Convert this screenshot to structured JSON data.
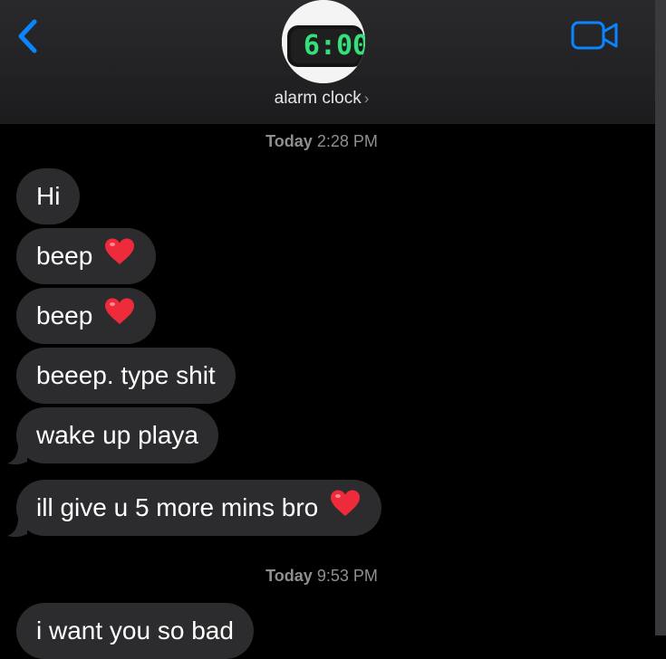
{
  "header": {
    "contact_name": "alarm clock",
    "avatar_clock_text": "6:00"
  },
  "timestamps": [
    {
      "day": "Today",
      "time": "2:28 PM"
    },
    {
      "day": "Today",
      "time": "9:53 PM"
    }
  ],
  "messages": [
    {
      "text": "Hi"
    },
    {
      "text": "beep",
      "emoji": "red-heart"
    },
    {
      "text": "beep",
      "emoji": "red-heart"
    },
    {
      "text": "beeep. type shit"
    },
    {
      "text": "wake up playa"
    },
    {
      "text": "ill give u 5 more mins bro",
      "emoji": "red-heart"
    },
    {
      "text": "i want you so bad"
    }
  ],
  "colors": {
    "accent": "#0a84ff",
    "bubble_incoming": "#2c2c2e",
    "background": "#000000",
    "clock_digits": "#35e07a"
  },
  "icons": [
    "back-chevron-icon",
    "video-camera-icon",
    "red-heart-icon"
  ]
}
